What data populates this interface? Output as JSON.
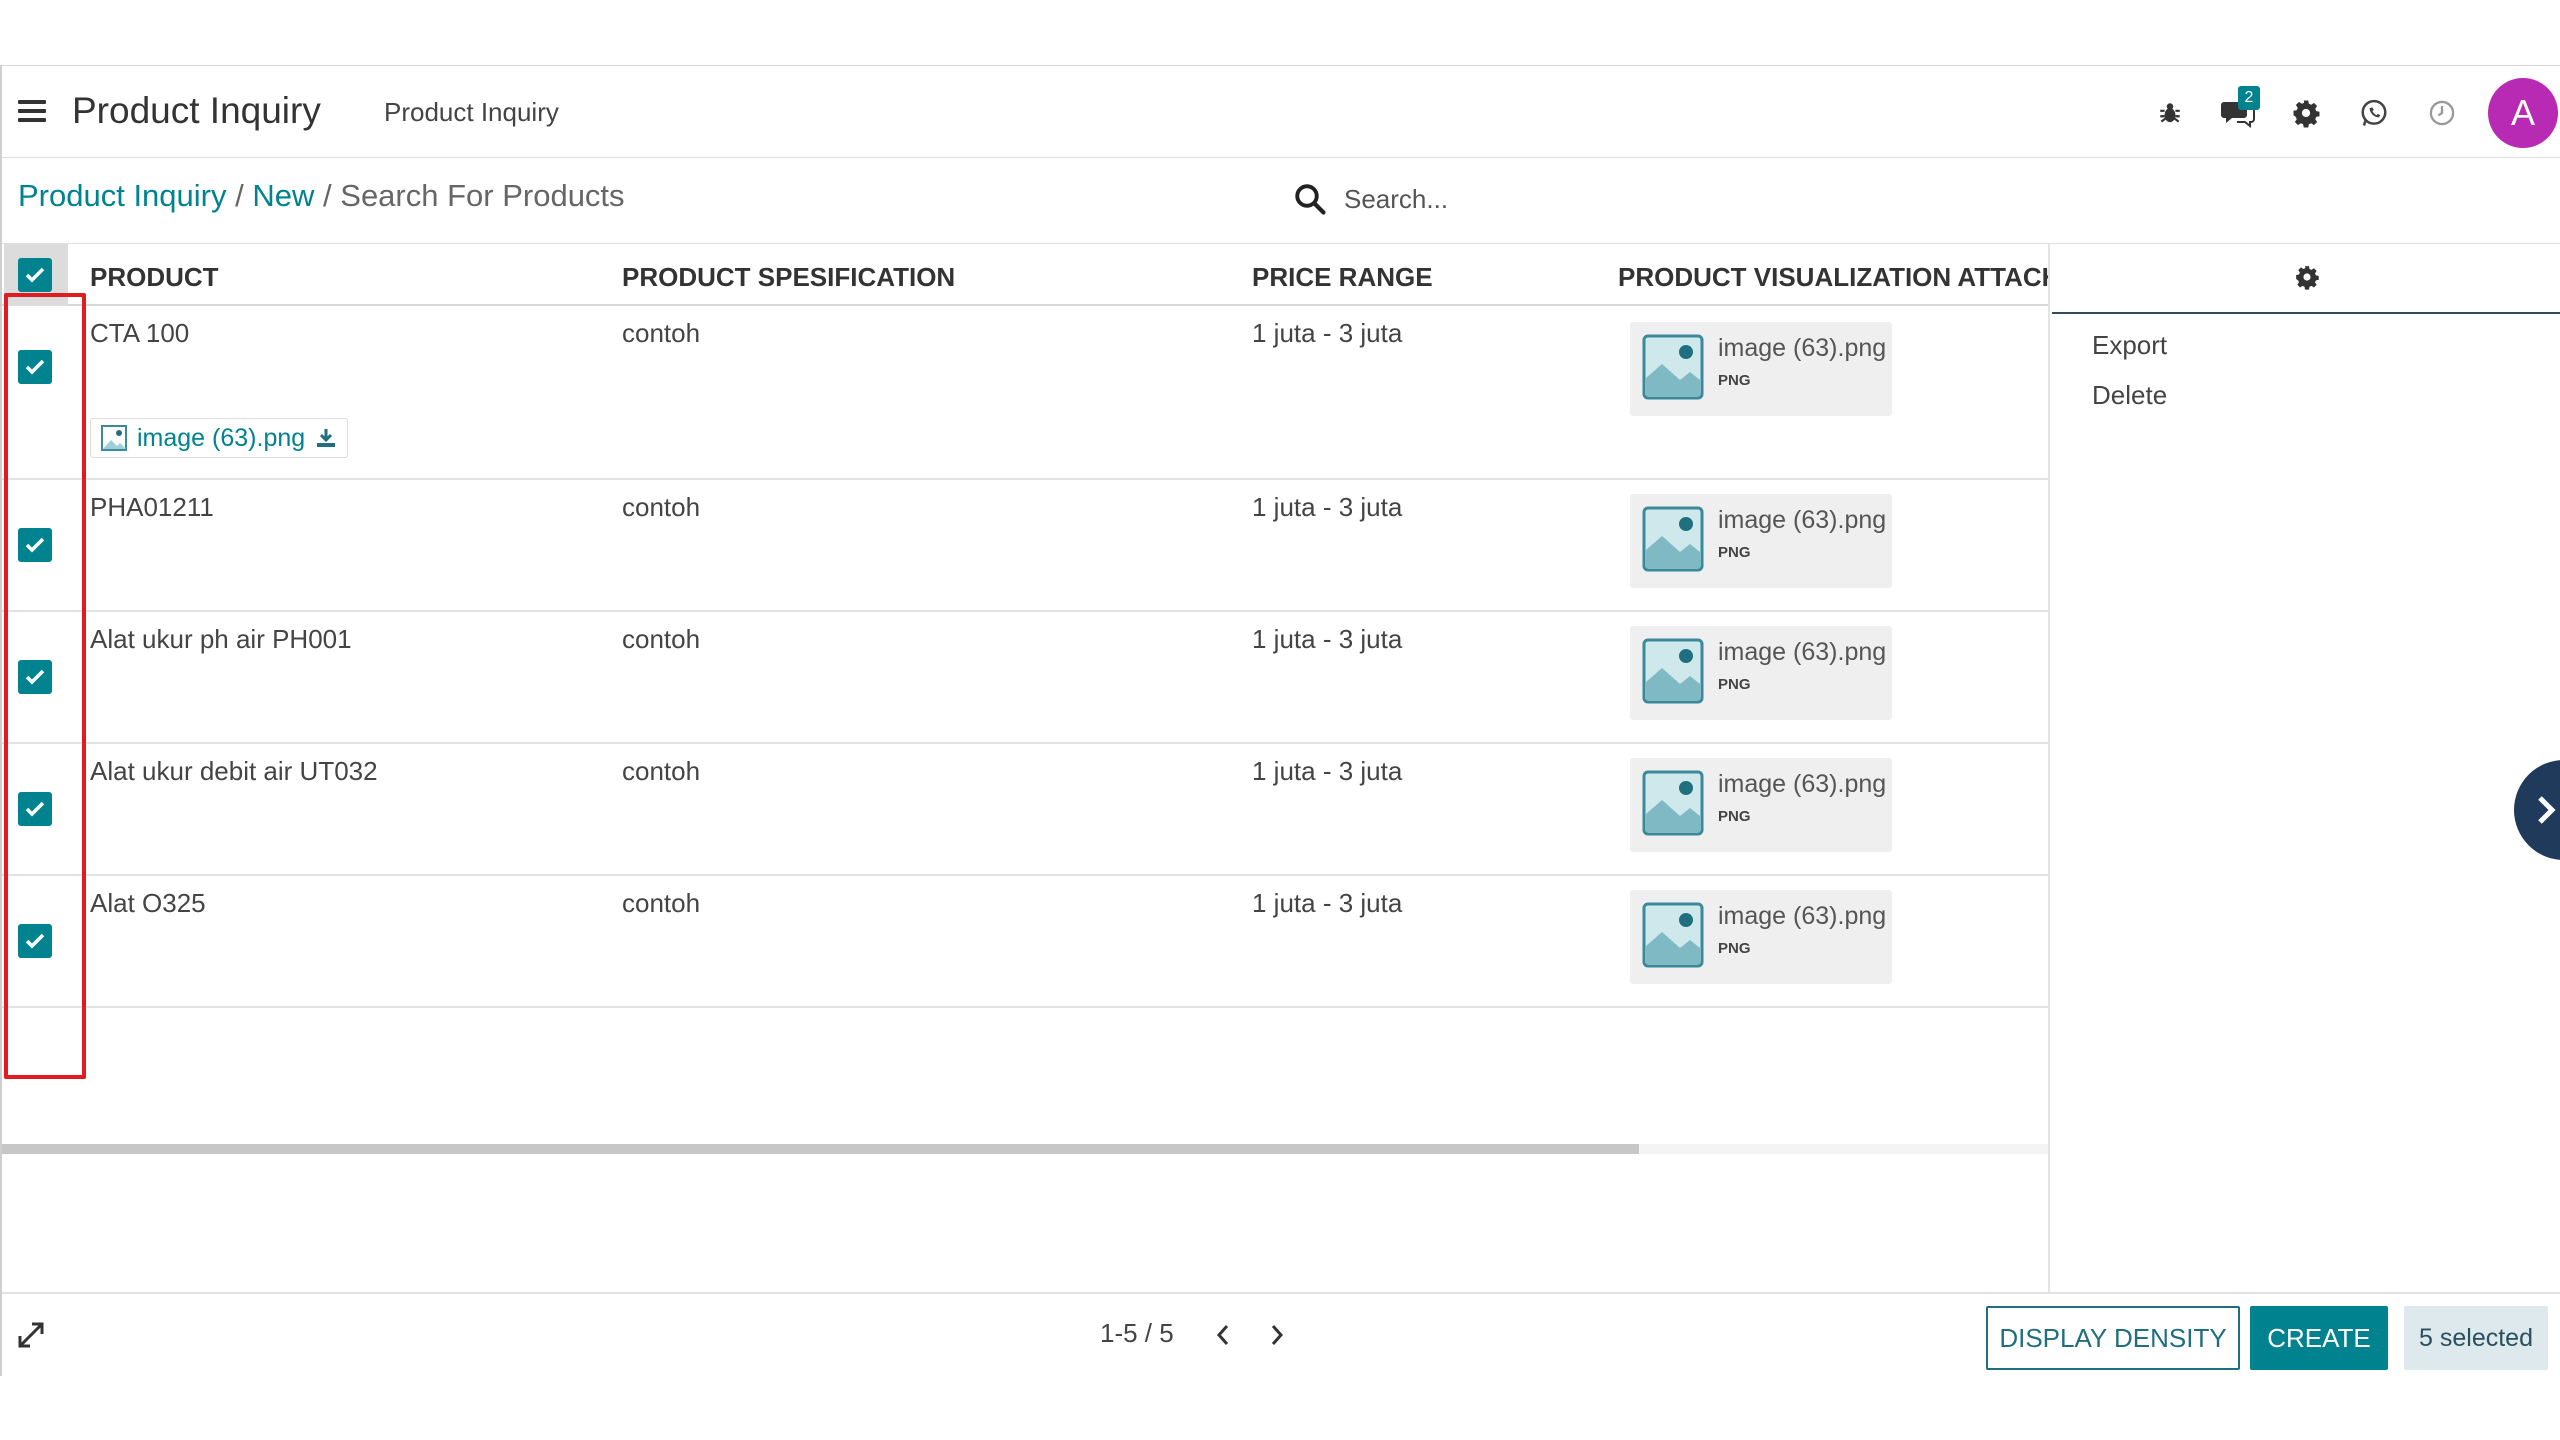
{
  "topbar": {
    "app_title": "Product Inquiry",
    "menu_item": "Product Inquiry",
    "chat_badge": "2",
    "avatar_letter": "A",
    "icons": [
      "bug-icon",
      "chat-icon",
      "gear-icon",
      "whatsapp-icon",
      "clock-icon"
    ]
  },
  "breadcrumb": {
    "items": [
      "Product Inquiry",
      "New"
    ],
    "separator": "/",
    "current": "Search For Products"
  },
  "search": {
    "placeholder": "Search..."
  },
  "table": {
    "columns": [
      "PRODUCT",
      "PRODUCT SPESIFICATION",
      "PRICE RANGE",
      "PRODUCT VISUALIZATION ATTACHM"
    ],
    "rows": [
      {
        "product": "CTA 100",
        "spec": "contoh",
        "price": "1 juta - 3 juta",
        "attachment": "image (63).png",
        "attachment_type": "PNG",
        "inline_attachment": "image (63).png",
        "checked": true
      },
      {
        "product": "PHA01211",
        "spec": "contoh",
        "price": "1 juta - 3 juta",
        "attachment": "image (63).png",
        "attachment_type": "PNG",
        "checked": true
      },
      {
        "product": "Alat ukur ph air PH001",
        "spec": "contoh",
        "price": "1 juta - 3 juta",
        "attachment": "image (63).png",
        "attachment_type": "PNG",
        "checked": true
      },
      {
        "product": "Alat ukur debit air UT032",
        "spec": "contoh",
        "price": "1 juta - 3 juta",
        "attachment": "image (63).png",
        "attachment_type": "PNG",
        "checked": true
      },
      {
        "product": "Alat O325",
        "spec": "contoh",
        "price": "1 juta - 3 juta",
        "attachment": "image (63).png",
        "attachment_type": "PNG",
        "checked": true
      }
    ]
  },
  "side_panel": {
    "actions": [
      "Export",
      "Delete"
    ]
  },
  "footer": {
    "pager": "1-5 / 5",
    "display_density": "DISPLAY DENSITY",
    "create": "CREATE",
    "selected": "5 selected"
  },
  "colors": {
    "accent": "#00838f",
    "avatar": "#b82ab3",
    "highlight": "#e11b22",
    "toggle": "#1f3a5b"
  }
}
